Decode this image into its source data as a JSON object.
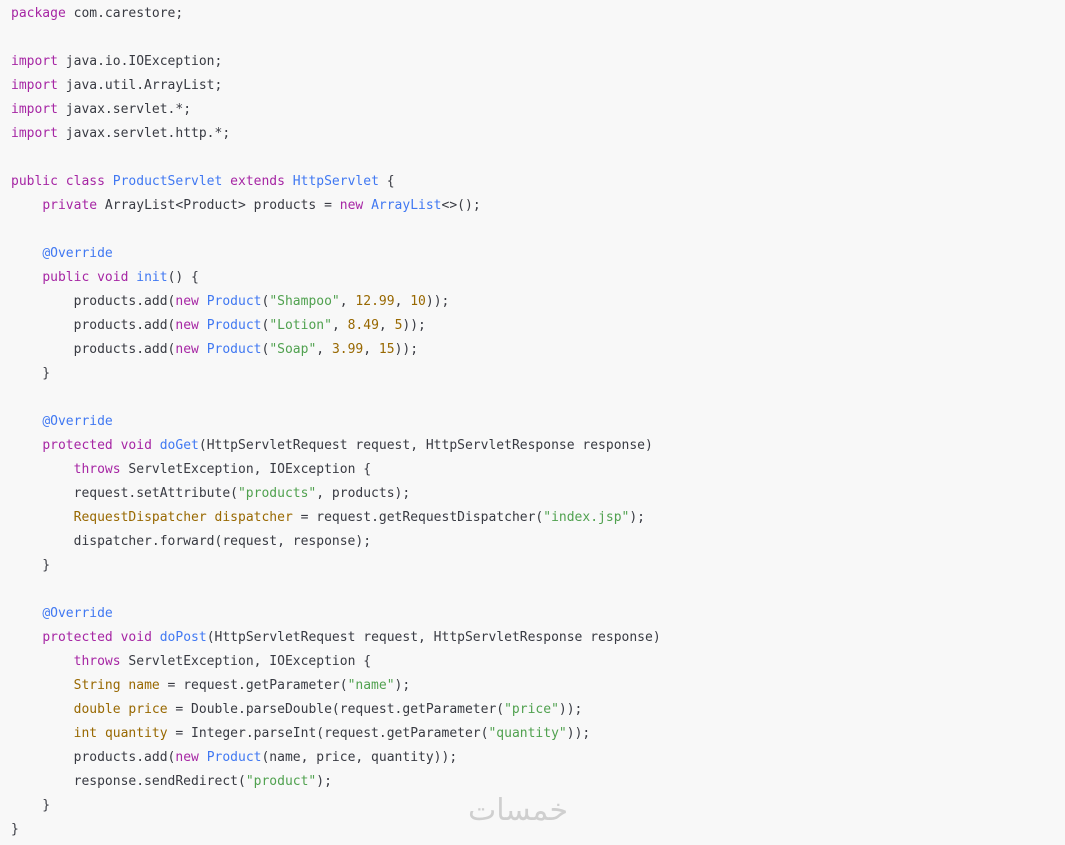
{
  "colors": {
    "background": "#f8f8f8",
    "keyword": "#a626a4",
    "type": "#4078f2",
    "string": "#50a14f",
    "number": "#986801",
    "variable": "#986801",
    "plain": "#383a42"
  },
  "watermark": "خمسات",
  "code": {
    "lines": [
      [
        {
          "t": "kw",
          "s": "package"
        },
        {
          "t": "plain",
          "s": " com.carestore;"
        }
      ],
      [],
      [
        {
          "t": "kw",
          "s": "import"
        },
        {
          "t": "plain",
          "s": " java.io.IOException;"
        }
      ],
      [
        {
          "t": "kw",
          "s": "import"
        },
        {
          "t": "plain",
          "s": " java.util.ArrayList;"
        }
      ],
      [
        {
          "t": "kw",
          "s": "import"
        },
        {
          "t": "plain",
          "s": " javax.servlet.*;"
        }
      ],
      [
        {
          "t": "kw",
          "s": "import"
        },
        {
          "t": "plain",
          "s": " javax.servlet.http.*;"
        }
      ],
      [],
      [
        {
          "t": "kw",
          "s": "public"
        },
        {
          "t": "plain",
          "s": " "
        },
        {
          "t": "kw",
          "s": "class"
        },
        {
          "t": "plain",
          "s": " "
        },
        {
          "t": "type",
          "s": "ProductServlet"
        },
        {
          "t": "plain",
          "s": " "
        },
        {
          "t": "kw",
          "s": "extends"
        },
        {
          "t": "plain",
          "s": " "
        },
        {
          "t": "type",
          "s": "HttpServlet"
        },
        {
          "t": "plain",
          "s": " {"
        }
      ],
      [
        {
          "t": "plain",
          "s": "    "
        },
        {
          "t": "kw",
          "s": "private"
        },
        {
          "t": "plain",
          "s": " ArrayList<Product> products = "
        },
        {
          "t": "kw",
          "s": "new"
        },
        {
          "t": "plain",
          "s": " "
        },
        {
          "t": "type",
          "s": "ArrayList"
        },
        {
          "t": "plain",
          "s": "<>();"
        }
      ],
      [],
      [
        {
          "t": "plain",
          "s": "    "
        },
        {
          "t": "ann",
          "s": "@Override"
        }
      ],
      [
        {
          "t": "plain",
          "s": "    "
        },
        {
          "t": "kw",
          "s": "public"
        },
        {
          "t": "plain",
          "s": " "
        },
        {
          "t": "kw",
          "s": "void"
        },
        {
          "t": "plain",
          "s": " "
        },
        {
          "t": "fn",
          "s": "init"
        },
        {
          "t": "plain",
          "s": "() {"
        }
      ],
      [
        {
          "t": "plain",
          "s": "        products.add("
        },
        {
          "t": "kw",
          "s": "new"
        },
        {
          "t": "plain",
          "s": " "
        },
        {
          "t": "type",
          "s": "Product"
        },
        {
          "t": "plain",
          "s": "("
        },
        {
          "t": "str",
          "s": "\"Shampoo\""
        },
        {
          "t": "plain",
          "s": ", "
        },
        {
          "t": "num",
          "s": "12.99"
        },
        {
          "t": "plain",
          "s": ", "
        },
        {
          "t": "num",
          "s": "10"
        },
        {
          "t": "plain",
          "s": "));"
        }
      ],
      [
        {
          "t": "plain",
          "s": "        products.add("
        },
        {
          "t": "kw",
          "s": "new"
        },
        {
          "t": "plain",
          "s": " "
        },
        {
          "t": "type",
          "s": "Product"
        },
        {
          "t": "plain",
          "s": "("
        },
        {
          "t": "str",
          "s": "\"Lotion\""
        },
        {
          "t": "plain",
          "s": ", "
        },
        {
          "t": "num",
          "s": "8.49"
        },
        {
          "t": "plain",
          "s": ", "
        },
        {
          "t": "num",
          "s": "5"
        },
        {
          "t": "plain",
          "s": "));"
        }
      ],
      [
        {
          "t": "plain",
          "s": "        products.add("
        },
        {
          "t": "kw",
          "s": "new"
        },
        {
          "t": "plain",
          "s": " "
        },
        {
          "t": "type",
          "s": "Product"
        },
        {
          "t": "plain",
          "s": "("
        },
        {
          "t": "str",
          "s": "\"Soap\""
        },
        {
          "t": "plain",
          "s": ", "
        },
        {
          "t": "num",
          "s": "3.99"
        },
        {
          "t": "plain",
          "s": ", "
        },
        {
          "t": "num",
          "s": "15"
        },
        {
          "t": "plain",
          "s": "));"
        }
      ],
      [
        {
          "t": "plain",
          "s": "    }"
        }
      ],
      [],
      [
        {
          "t": "plain",
          "s": "    "
        },
        {
          "t": "ann",
          "s": "@Override"
        }
      ],
      [
        {
          "t": "plain",
          "s": "    "
        },
        {
          "t": "kw",
          "s": "protected"
        },
        {
          "t": "plain",
          "s": " "
        },
        {
          "t": "kw",
          "s": "void"
        },
        {
          "t": "plain",
          "s": " "
        },
        {
          "t": "fn",
          "s": "doGet"
        },
        {
          "t": "plain",
          "s": "(HttpServletRequest request, HttpServletResponse response)"
        }
      ],
      [
        {
          "t": "plain",
          "s": "        "
        },
        {
          "t": "kw",
          "s": "throws"
        },
        {
          "t": "plain",
          "s": " ServletException, IOException {"
        }
      ],
      [
        {
          "t": "plain",
          "s": "        request.setAttribute("
        },
        {
          "t": "str",
          "s": "\"products\""
        },
        {
          "t": "plain",
          "s": ", products);"
        }
      ],
      [
        {
          "t": "plain",
          "s": "        "
        },
        {
          "t": "var",
          "s": "RequestDispatcher"
        },
        {
          "t": "plain",
          "s": " "
        },
        {
          "t": "var",
          "s": "dispatcher"
        },
        {
          "t": "plain",
          "s": " = request.getRequestDispatcher("
        },
        {
          "t": "str",
          "s": "\"index.jsp\""
        },
        {
          "t": "plain",
          "s": ");"
        }
      ],
      [
        {
          "t": "plain",
          "s": "        dispatcher.forward(request, response);"
        }
      ],
      [
        {
          "t": "plain",
          "s": "    }"
        }
      ],
      [],
      [
        {
          "t": "plain",
          "s": "    "
        },
        {
          "t": "ann",
          "s": "@Override"
        }
      ],
      [
        {
          "t": "plain",
          "s": "    "
        },
        {
          "t": "kw",
          "s": "protected"
        },
        {
          "t": "plain",
          "s": " "
        },
        {
          "t": "kw",
          "s": "void"
        },
        {
          "t": "plain",
          "s": " "
        },
        {
          "t": "fn",
          "s": "doPost"
        },
        {
          "t": "plain",
          "s": "(HttpServletRequest request, HttpServletResponse response)"
        }
      ],
      [
        {
          "t": "plain",
          "s": "        "
        },
        {
          "t": "kw",
          "s": "throws"
        },
        {
          "t": "plain",
          "s": " ServletException, IOException {"
        }
      ],
      [
        {
          "t": "plain",
          "s": "        "
        },
        {
          "t": "var",
          "s": "String"
        },
        {
          "t": "plain",
          "s": " "
        },
        {
          "t": "var",
          "s": "name"
        },
        {
          "t": "plain",
          "s": " = request.getParameter("
        },
        {
          "t": "str",
          "s": "\"name\""
        },
        {
          "t": "plain",
          "s": ");"
        }
      ],
      [
        {
          "t": "plain",
          "s": "        "
        },
        {
          "t": "var",
          "s": "double"
        },
        {
          "t": "plain",
          "s": " "
        },
        {
          "t": "var",
          "s": "price"
        },
        {
          "t": "plain",
          "s": " = Double.parseDouble(request.getParameter("
        },
        {
          "t": "str",
          "s": "\"price\""
        },
        {
          "t": "plain",
          "s": "));"
        }
      ],
      [
        {
          "t": "plain",
          "s": "        "
        },
        {
          "t": "var",
          "s": "int"
        },
        {
          "t": "plain",
          "s": " "
        },
        {
          "t": "var",
          "s": "quantity"
        },
        {
          "t": "plain",
          "s": " = Integer.parseInt(request.getParameter("
        },
        {
          "t": "str",
          "s": "\"quantity\""
        },
        {
          "t": "plain",
          "s": "));"
        }
      ],
      [
        {
          "t": "plain",
          "s": "        products.add("
        },
        {
          "t": "kw",
          "s": "new"
        },
        {
          "t": "plain",
          "s": " "
        },
        {
          "t": "type",
          "s": "Product"
        },
        {
          "t": "plain",
          "s": "(name, price, quantity));"
        }
      ],
      [
        {
          "t": "plain",
          "s": "        response.sendRedirect("
        },
        {
          "t": "str",
          "s": "\"product\""
        },
        {
          "t": "plain",
          "s": ");"
        }
      ],
      [
        {
          "t": "plain",
          "s": "    }"
        }
      ],
      [
        {
          "t": "plain",
          "s": "}"
        }
      ]
    ]
  }
}
